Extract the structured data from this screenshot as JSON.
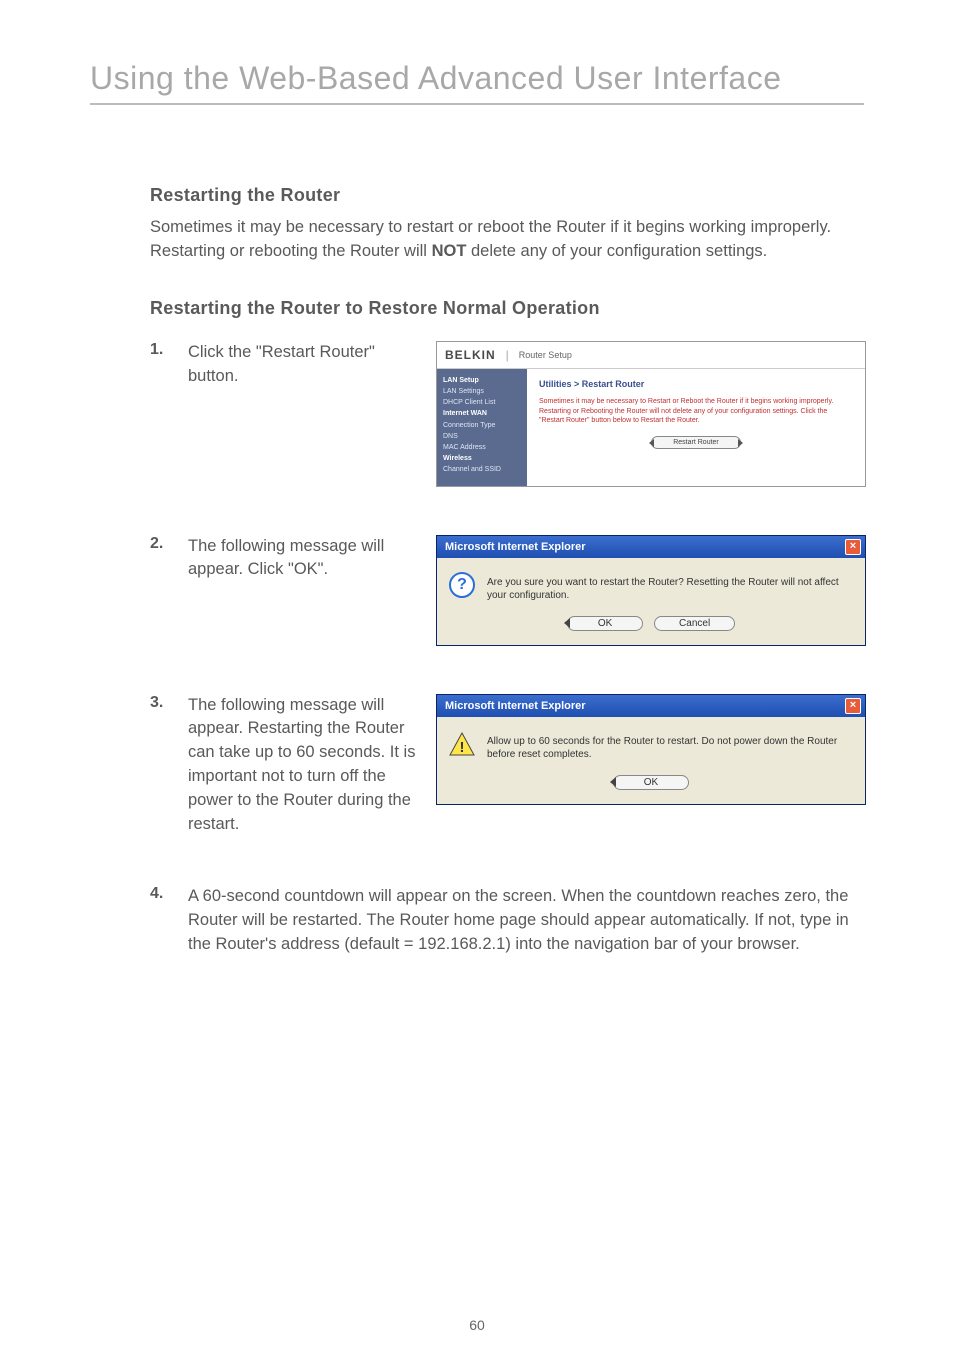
{
  "title": "Using the Web-Based Advanced User Interface",
  "section1": {
    "heading": "Restarting the Router",
    "body_pre": "Sometimes it may be necessary to restart or reboot the Router if it begins working improperly. Restarting or rebooting the Router will ",
    "body_bold": "NOT",
    "body_post": " delete any of your configuration settings."
  },
  "section2": {
    "heading": "Restarting the Router to Restore Normal Operation"
  },
  "steps": {
    "s1": {
      "num": "1.",
      "text": "Click the \"Restart Router\" button."
    },
    "s2": {
      "num": "2.",
      "text": "The following message will appear. Click \"OK\"."
    },
    "s3": {
      "num": "3.",
      "text": "The following message will appear. Restarting the Router can take up to 60 seconds. It is important not to turn off the power to the Router during the restart."
    },
    "s4": {
      "num": "4.",
      "text": "A 60-second countdown will appear on the screen. When the countdown reaches zero, the Router will be restarted. The Router home page should appear automatically. If not, type in the Router's address (default = 192.168.2.1) into the navigation bar of your browser."
    }
  },
  "shot1": {
    "logo": "BELKIN",
    "subtitle": "Router Setup",
    "nav": {
      "h1": "LAN Setup",
      "i1": "LAN Settings",
      "i2": "DHCP Client List",
      "h2": "Internet WAN",
      "i3": "Connection Type",
      "i4": "DNS",
      "i5": "MAC Address",
      "h3": "Wireless",
      "i6": "Channel and SSID"
    },
    "panel_title": "Utilities > Restart Router",
    "panel_body": "Sometimes it may be necessary to Restart or Reboot the Router if it begins working improperly. Restarting or Rebooting the Router will not delete any of your configuration settings. Click the \"Restart Router\" button below to Restart the Router.",
    "button": "Restart Router"
  },
  "dialog": {
    "title": "Microsoft Internet Explorer",
    "body1": "Are you sure you want to restart the Router? Resetting the Router will not affect your configuration.",
    "body2": "Allow up to 60 seconds for the Router to restart. Do not power down the Router before reset completes.",
    "ok": "OK",
    "cancel": "Cancel"
  },
  "page_number": "60"
}
